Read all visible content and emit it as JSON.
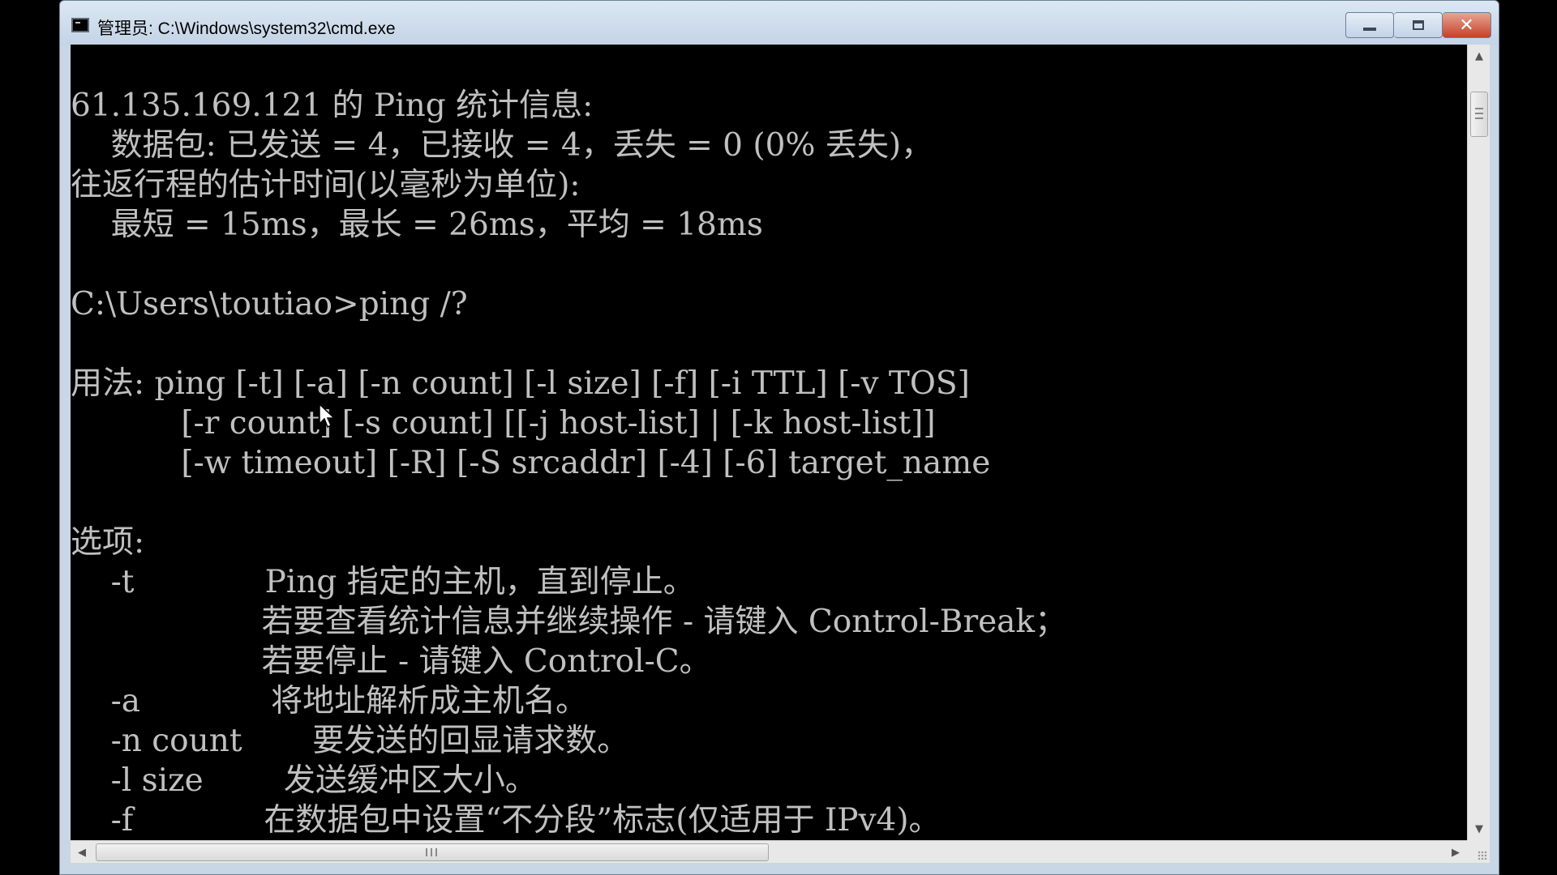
{
  "window": {
    "title": "管理员: C:\\Windows\\system32\\cmd.exe",
    "close_glyph": "✕"
  },
  "console": {
    "lines": [
      "",
      "61.135.169.121 的 Ping 统计信息:",
      "    数据包: 已发送 = 4，已接收 = 4，丢失 = 0 (0% 丢失)，",
      "往返行程的估计时间(以毫秒为单位):",
      "    最短 = 15ms，最长 = 26ms，平均 = 18ms",
      "",
      "C:\\Users\\toutiao>ping /?",
      "",
      "用法: ping [-t] [-a] [-n count] [-l size] [-f] [-i TTL] [-v TOS]",
      "           [-r count] [-s count] [[-j host-list] | [-k host-list]]",
      "           [-w timeout] [-R] [-S srcaddr] [-4] [-6] target_name",
      "",
      "选项:",
      "    -t             Ping 指定的主机，直到停止。",
      "                   若要查看统计信息并继续操作 - 请键入 Control-Break；",
      "                   若要停止 - 请键入 Control-C。",
      "    -a             将地址解析成主机名。",
      "    -n count       要发送的回显请求数。",
      "    -l size        发送缓冲区大小。",
      "    -f             在数据包中设置“不分段”标志(仅适用于 IPv4)。"
    ]
  },
  "scrollbars": {
    "up_arrow": "▲",
    "down_arrow": "▼",
    "left_arrow": "◀",
    "right_arrow": "▶"
  },
  "icons": {
    "app": "console-icon",
    "minimize": "minimize-icon",
    "maximize": "maximize-icon",
    "close": "close-icon",
    "pointer": "mouse-pointer-icon"
  }
}
